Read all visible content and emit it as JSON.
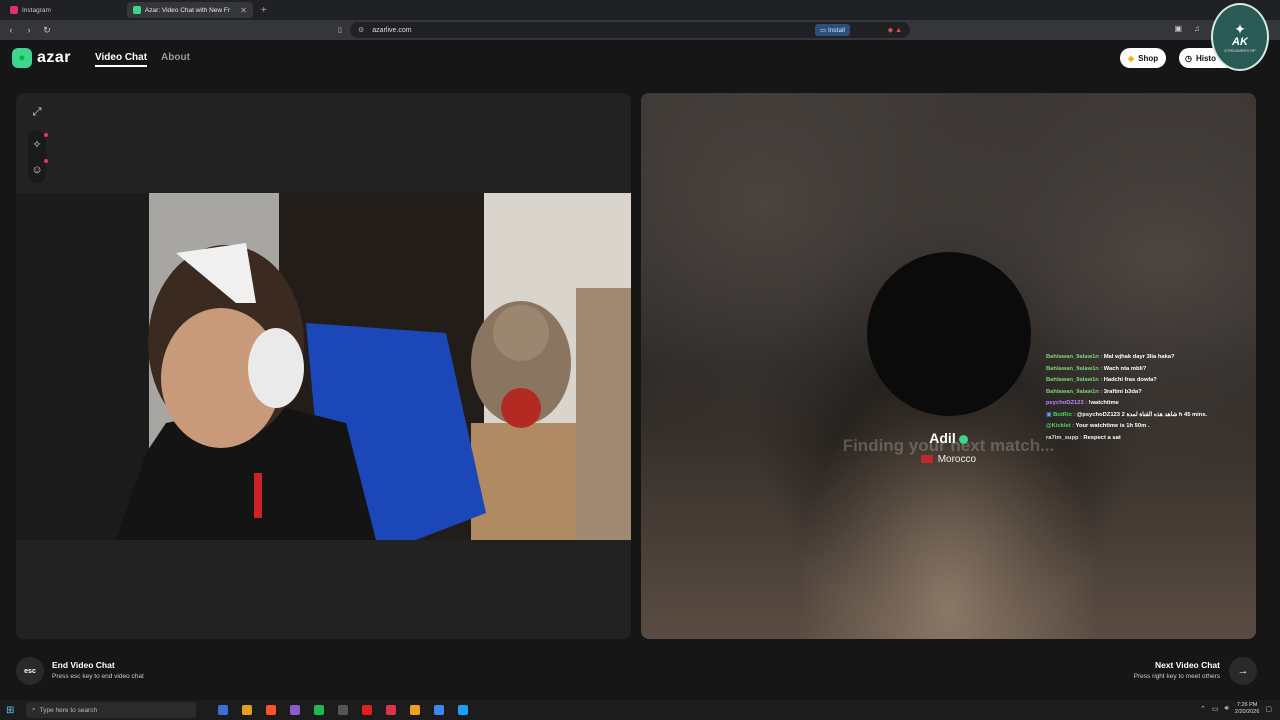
{
  "browser": {
    "tabs": [
      {
        "label": "Instagram",
        "active": false,
        "favicon_color": "#e1306c"
      },
      {
        "label": "Azar: Video Chat with New Fr",
        "active": true,
        "favicon_color": "#3dd68c"
      }
    ],
    "new_tab_icon": "plus-icon",
    "url": "azarlive.com",
    "install_label": "Install"
  },
  "header": {
    "logo_text": "azar",
    "nav": [
      {
        "label": "Video Chat",
        "active": true
      },
      {
        "label": "About",
        "active": false
      }
    ],
    "shop_label": "Shop",
    "history_label": "Histo"
  },
  "overlay_badge": {
    "title": "AK",
    "subtitle": "STREAMERS RP"
  },
  "left_panel": {
    "tools": [
      "expand-icon",
      "magic-wand-icon",
      "sticker-icon"
    ]
  },
  "right_panel": {
    "finding_text": "Finding your next match...",
    "username": "Adil",
    "country": "Morocco"
  },
  "chat": [
    {
      "user": "Bahlawan_9alaw1n",
      "message": "Mal wjhak dayr 3lia haka?",
      "color": "#7cd37a"
    },
    {
      "user": "Bahlawan_9alaw1n",
      "message": "Wach nta mbli?",
      "color": "#7cd37a"
    },
    {
      "user": "Bahlawan_9alaw1n",
      "message": "Hadchi fras dowla?",
      "color": "#7cd37a"
    },
    {
      "user": "Bahlawan_9alaw1n",
      "message": "3raftini b3da?",
      "color": "#7cd37a"
    },
    {
      "user": "psychoDZ123",
      "message": "!watchtime",
      "color": "#b58cff"
    },
    {
      "user": "BotRix",
      "message": "@psychoDZ123 2 شاهد هذه القناة لمدة h 45 mins.",
      "color": "#4ad95f"
    },
    {
      "user": "@Kicklet",
      "message": "Your watchtime is 1h 50m .",
      "color": "#4ad95f"
    },
    {
      "user": "ra7im_supp",
      "message": "Respect a sat",
      "color": "#dddddd"
    }
  ],
  "footer": {
    "esc_label": "esc",
    "end_title": "End Video Chat",
    "end_hint": "Press esc key to end video chat",
    "next_title": "Next Video Chat",
    "next_hint": "Press right key to meet others"
  },
  "taskbar": {
    "search_placeholder": "Type here to search",
    "time": "7:26 PM",
    "date": "2/20/2026",
    "app_colors": [
      "#3a6fd8",
      "#e0a020",
      "#fb542b",
      "#8a5cd0",
      "#1db954",
      "#555555",
      "#e02020",
      "#e0334a",
      "#f0a020",
      "#4285f4",
      "#1a9fff"
    ]
  }
}
